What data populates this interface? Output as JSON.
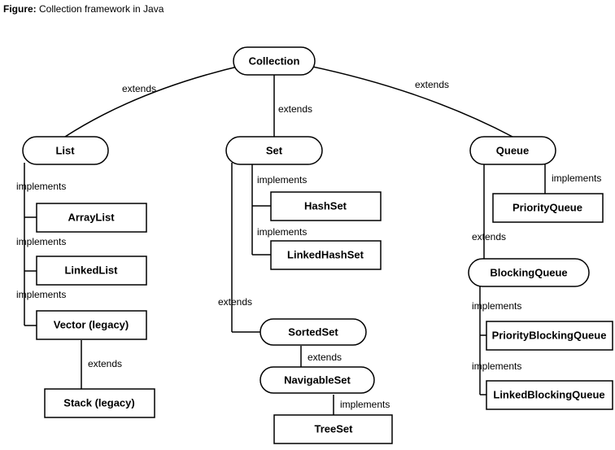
{
  "caption_prefix": "Figure:",
  "caption_text": " Collection framework in Java",
  "rel": {
    "extends": "extends",
    "implements": "implements"
  },
  "nodes": {
    "collection": "Collection",
    "list": "List",
    "set": "Set",
    "queue": "Queue",
    "arraylist": "ArrayList",
    "linkedlist": "LinkedList",
    "vector": "Vector (legacy)",
    "stack": "Stack (legacy)",
    "hashset": "HashSet",
    "linkedhashset": "LinkedHashSet",
    "sortedset": "SortedSet",
    "navigableset": "NavigableSet",
    "treeset": "TreeSet",
    "priorityqueue": "PriorityQueue",
    "blockingqueue": "BlockingQueue",
    "priorityblockingqueue": "PriorityBlockingQueue",
    "linkedblockingqueue": "LinkedBlockingQueue"
  },
  "hierarchy": {
    "root": "Collection",
    "children": [
      {
        "name": "List",
        "relation": "extends",
        "children": [
          {
            "name": "ArrayList",
            "relation": "implements"
          },
          {
            "name": "LinkedList",
            "relation": "implements"
          },
          {
            "name": "Vector (legacy)",
            "relation": "implements",
            "children": [
              {
                "name": "Stack (legacy)",
                "relation": "extends"
              }
            ]
          }
        ]
      },
      {
        "name": "Set",
        "relation": "extends",
        "children": [
          {
            "name": "HashSet",
            "relation": "implements"
          },
          {
            "name": "LinkedHashSet",
            "relation": "implements"
          },
          {
            "name": "SortedSet",
            "relation": "extends",
            "children": [
              {
                "name": "NavigableSet",
                "relation": "extends",
                "children": [
                  {
                    "name": "TreeSet",
                    "relation": "implements"
                  }
                ]
              }
            ]
          }
        ]
      },
      {
        "name": "Queue",
        "relation": "extends",
        "children": [
          {
            "name": "PriorityQueue",
            "relation": "implements"
          },
          {
            "name": "BlockingQueue",
            "relation": "extends",
            "children": [
              {
                "name": "PriorityBlockingQueue",
                "relation": "implements"
              },
              {
                "name": "LinkedBlockingQueue",
                "relation": "implements"
              }
            ]
          }
        ]
      }
    ]
  }
}
